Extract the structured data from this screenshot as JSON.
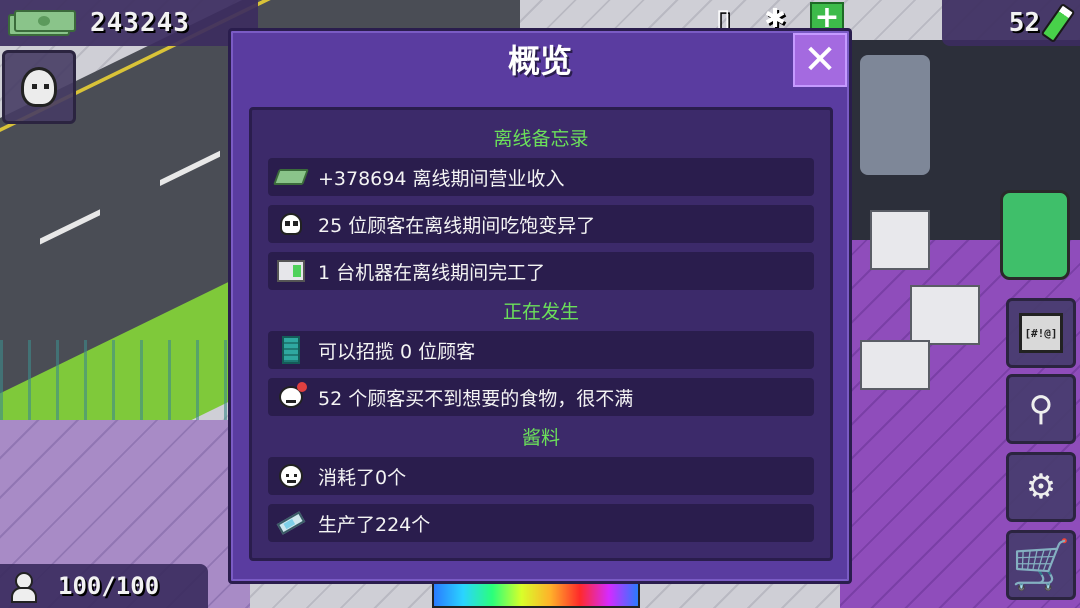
{
  "hud": {
    "money": "243243",
    "energy": "52",
    "customers": "100/100",
    "gift_label": "[#!@]"
  },
  "modal": {
    "title": "概览",
    "close_label": "✕",
    "sections": [
      {
        "title": "离线备忘录",
        "rows": [
          {
            "icon": "cash-icon",
            "text": "+378694 离线期间营业收入"
          },
          {
            "icon": "mutant-face-icon",
            "text": "25 位顾客在离线期间吃饱变异了"
          },
          {
            "icon": "machine-icon",
            "text": "1 台机器在离线期间完工了"
          }
        ]
      },
      {
        "title": "正在发生",
        "rows": [
          {
            "icon": "building-icon",
            "text": "可以招揽 0 位顾客"
          },
          {
            "icon": "angry-customer-icon",
            "text": "52 个顾客买不到想要的食物，很不满"
          }
        ]
      },
      {
        "title": "酱料",
        "rows": [
          {
            "icon": "sauce-face-icon",
            "text": "消耗了0个"
          },
          {
            "icon": "syringe-icon",
            "text": "生产了224个"
          }
        ]
      }
    ]
  },
  "colors": {
    "section_title": "#6be05a",
    "modal_bg": "#5a3ca0",
    "body_bg": "#3c2a6a",
    "row_bg": "#2a1d4d",
    "close_bg": "#a46ae0"
  }
}
